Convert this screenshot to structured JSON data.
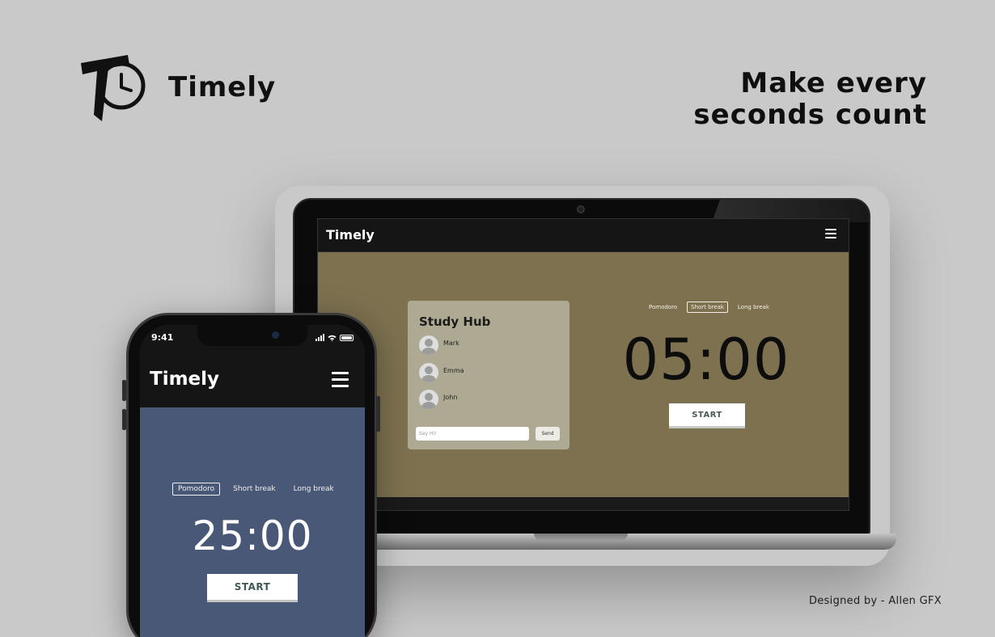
{
  "brand": {
    "name": "Timely",
    "logo_letter": "T",
    "tagline_line1": "Make every",
    "tagline_line2": "seconds count",
    "credit": "Designed by - Allen GFX"
  },
  "laptop": {
    "app_title": "Timely",
    "study_hub": {
      "title": "Study Hub",
      "users": [
        "Mark",
        "Emma",
        "John"
      ],
      "chat_placeholder": "Say Hi!",
      "send_label": "Send"
    },
    "tabs": [
      {
        "label": "Pomodoro",
        "active": false
      },
      {
        "label": "Short break",
        "active": true
      },
      {
        "label": "Long break",
        "active": false
      }
    ],
    "timer": "05:00",
    "start_label": "START",
    "background_color": "#7d7150"
  },
  "phone": {
    "status_time": "9:41",
    "app_title": "Timely",
    "tabs": [
      {
        "label": "Pomodoro",
        "active": true
      },
      {
        "label": "Short break",
        "active": false
      },
      {
        "label": "Long break",
        "active": false
      }
    ],
    "timer": "25:00",
    "start_label": "START",
    "background_color": "#4a5878"
  },
  "icons": [
    "timely-logo-icon",
    "hamburger-menu-icon",
    "avatar-icon",
    "signal-icon",
    "wifi-icon",
    "battery-icon"
  ]
}
